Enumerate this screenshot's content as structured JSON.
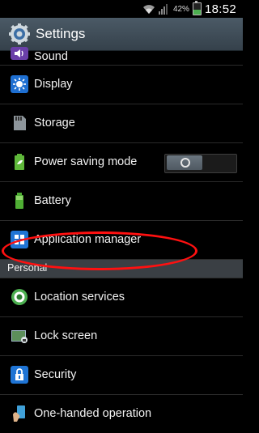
{
  "status_bar": {
    "battery_percent": "42%",
    "time": "18:52",
    "icons": [
      "wifi-icon",
      "signal-icon",
      "battery-charging-icon"
    ]
  },
  "title_bar": {
    "title": "Settings",
    "icon": "gear-icon"
  },
  "items": [
    {
      "label": "Sound",
      "icon": "sound-icon"
    },
    {
      "label": "Display",
      "icon": "display-icon"
    },
    {
      "label": "Storage",
      "icon": "storage-icon"
    },
    {
      "label": "Power saving mode",
      "icon": "power-saving-icon",
      "toggle": {
        "state": "off"
      }
    },
    {
      "label": "Battery",
      "icon": "battery-icon"
    },
    {
      "label": "Application manager",
      "icon": "app-grid-icon",
      "highlighted": true
    }
  ],
  "section_personal": {
    "label": "Personal"
  },
  "personal_items": [
    {
      "label": "Location services",
      "icon": "location-icon"
    },
    {
      "label": "Lock screen",
      "icon": "lock-screen-icon"
    },
    {
      "label": "Security",
      "icon": "security-icon"
    },
    {
      "label": "One-handed operation",
      "icon": "one-handed-icon"
    }
  ],
  "colors": {
    "annotation": "#ff1010",
    "title_bar": "#3f4c57",
    "section_header": "#3a3f44"
  }
}
